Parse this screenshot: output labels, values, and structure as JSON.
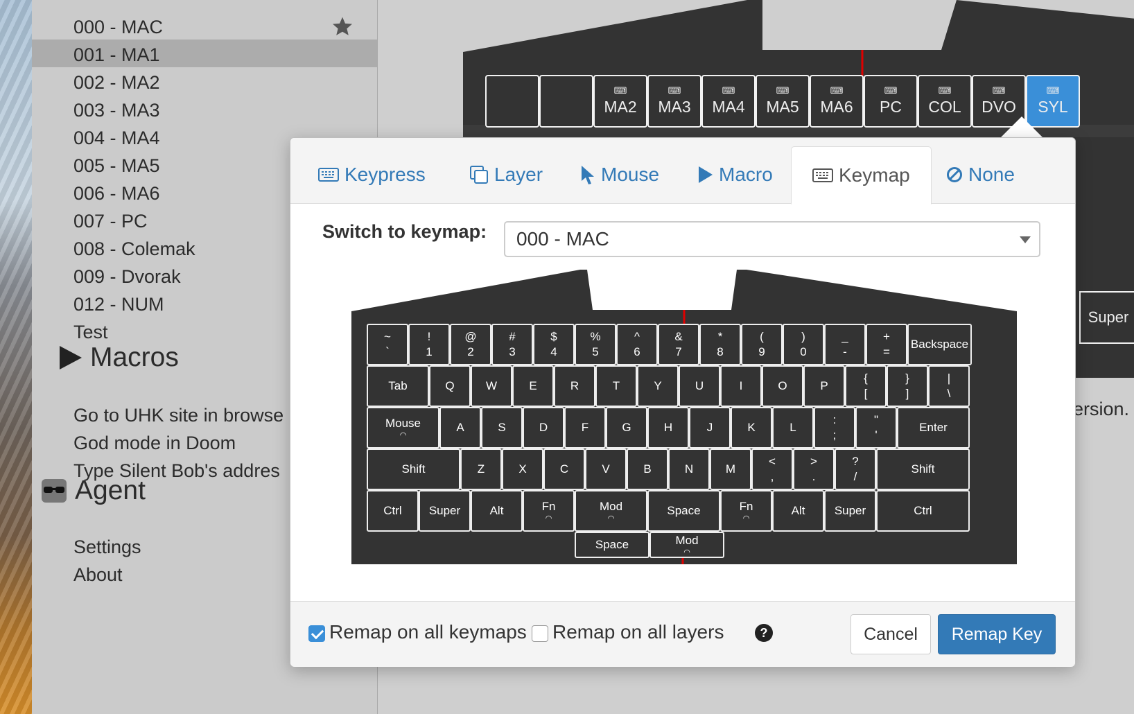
{
  "sidebar": {
    "keymaps": [
      {
        "label": "000 - MAC",
        "starred": true
      },
      {
        "label": "001 - MA1",
        "selected": true
      },
      {
        "label": "002 - MA2"
      },
      {
        "label": "003 - MA3"
      },
      {
        "label": "004 - MA4"
      },
      {
        "label": "005 - MA5"
      },
      {
        "label": "006 - MA6"
      },
      {
        "label": "007 - PC"
      },
      {
        "label": "008 - Colemak"
      },
      {
        "label": "009 - Dvorak"
      },
      {
        "label": "012 - NUM"
      },
      {
        "label": "Test"
      }
    ],
    "macros_heading": "Macros",
    "macros": [
      "Go to UHK site in browse",
      "God mode in Doom",
      "Type Silent Bob's addres"
    ],
    "agent_heading": "Agent",
    "agent_items": [
      "Settings",
      "About"
    ]
  },
  "background_keyboard": {
    "top_row": [
      "MA2",
      "MA3",
      "MA4",
      "MA5",
      "MA6",
      "PC",
      "COL",
      "DVO",
      "SYL"
    ],
    "super_label": "Super",
    "side_text": "ersion."
  },
  "popover": {
    "tabs": [
      {
        "label": "Keypress",
        "icon": "keyboard-icon"
      },
      {
        "label": "Layer",
        "icon": "layers-icon"
      },
      {
        "label": "Mouse",
        "icon": "mouse-pointer-icon"
      },
      {
        "label": "Macro",
        "icon": "play-icon"
      },
      {
        "label": "Keymap",
        "icon": "keyboard-icon",
        "active": true
      },
      {
        "label": "None",
        "icon": "ban-icon"
      }
    ],
    "switch_label": "Switch to keymap:",
    "selected_keymap": "000 - MAC",
    "footer": {
      "remap_all_keymaps": "Remap on all keymaps",
      "remap_all_keymaps_checked": true,
      "remap_all_layers": "Remap on all layers",
      "remap_all_layers_checked": false,
      "help": "?",
      "cancel": "Cancel",
      "remap": "Remap Key"
    }
  },
  "keyboard": {
    "row1": [
      [
        "~",
        "`"
      ],
      [
        "!",
        "1"
      ],
      [
        "@",
        "2"
      ],
      [
        "#",
        "3"
      ],
      [
        "$",
        "4"
      ],
      [
        "%",
        "5"
      ],
      [
        "^",
        "6"
      ],
      [
        "&",
        "7"
      ],
      [
        "*",
        "8"
      ],
      [
        "(",
        "9"
      ],
      [
        ")",
        "0"
      ],
      [
        "_",
        "-"
      ],
      [
        "+",
        "="
      ],
      [
        "Backspace"
      ]
    ],
    "row2": [
      [
        "Tab"
      ],
      [
        "Q"
      ],
      [
        "W"
      ],
      [
        "E"
      ],
      [
        "R"
      ],
      [
        "T"
      ],
      [
        "Y"
      ],
      [
        "U"
      ],
      [
        "I"
      ],
      [
        "O"
      ],
      [
        "P"
      ],
      [
        "{",
        "["
      ],
      [
        "}",
        "]"
      ],
      [
        "|",
        "\\"
      ]
    ],
    "row3": [
      [
        "Mouse"
      ],
      [
        "A"
      ],
      [
        "S"
      ],
      [
        "D"
      ],
      [
        "F"
      ],
      [
        "G"
      ],
      [
        "H"
      ],
      [
        "J"
      ],
      [
        "K"
      ],
      [
        "L"
      ],
      [
        ":",
        ";"
      ],
      [
        "\"",
        "'"
      ],
      [
        "Enter"
      ]
    ],
    "row4": [
      [
        "Shift"
      ],
      [
        "Z"
      ],
      [
        "X"
      ],
      [
        "C"
      ],
      [
        "V"
      ],
      [
        "B"
      ],
      [
        "N"
      ],
      [
        "M"
      ],
      [
        "<",
        ","
      ],
      [
        ">",
        "."
      ],
      [
        "?",
        "/"
      ],
      [
        "Shift"
      ]
    ],
    "row5": [
      [
        "Ctrl"
      ],
      [
        "Super"
      ],
      [
        "Alt"
      ],
      [
        "Fn"
      ],
      [
        "Mod"
      ],
      [
        "Space"
      ],
      [
        "Fn"
      ],
      [
        "Alt"
      ],
      [
        "Super"
      ],
      [
        "Ctrl"
      ]
    ],
    "row6": [
      [
        "Space"
      ],
      [
        "Mod"
      ]
    ]
  }
}
